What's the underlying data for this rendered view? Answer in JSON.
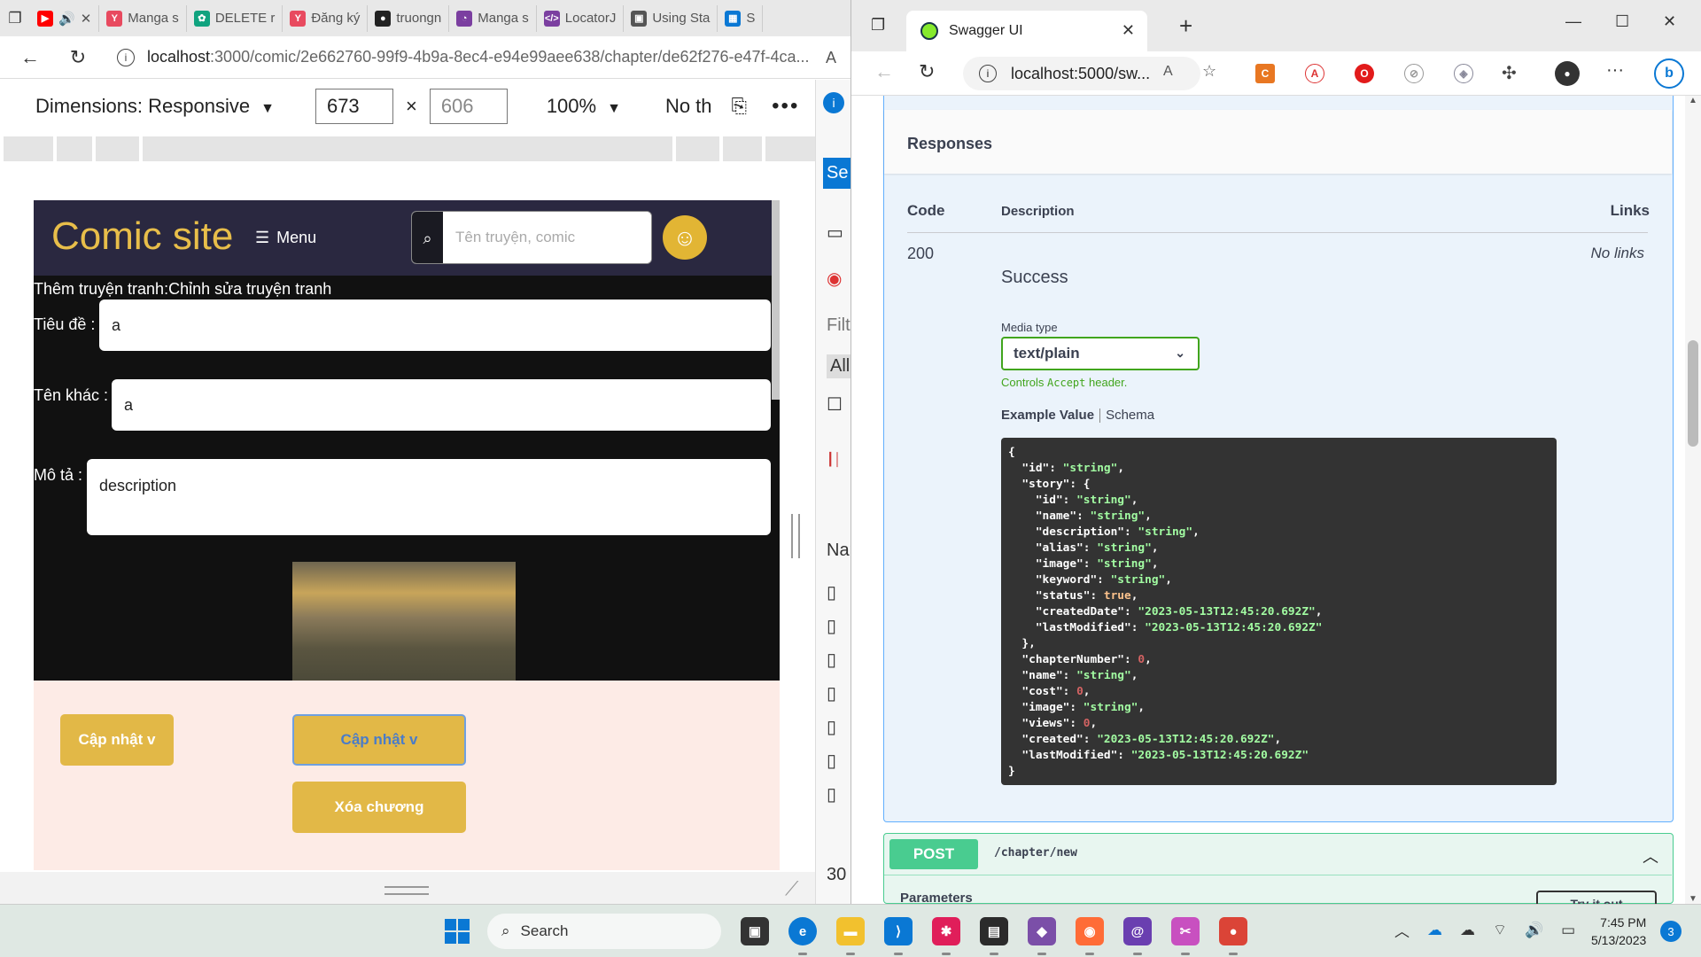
{
  "left_browser": {
    "tabs": [
      {
        "label": "",
        "icon": "youtube-icon",
        "color": "#ff0000"
      },
      {
        "label": "Manga s",
        "icon": "manga-icon",
        "color": "#e84a5f"
      },
      {
        "label": "DELETE r",
        "icon": "chatgpt-icon",
        "color": "#10a37f"
      },
      {
        "label": "Đăng ký",
        "icon": "manga-icon",
        "color": "#e84a5f"
      },
      {
        "label": "truongn",
        "icon": "github-icon",
        "color": "#222222"
      },
      {
        "label": "Manga s",
        "icon": "manga-icon",
        "color": "#7b3fa0"
      },
      {
        "label": "LocatorJ",
        "icon": "locator-icon",
        "color": "#7b3fa0"
      },
      {
        "label": "Using Sta",
        "icon": "video-icon",
        "color": "#555555"
      },
      {
        "label": "S",
        "icon": "windows-icon",
        "color": "#0a78d4"
      }
    ],
    "url_host": "localhost",
    "url_path": ":3000/comic/2e662760-99f9-4b9a-8ec4-e94e99aee638/chapter/de62f276-e47f-4ca...",
    "device_toolbar": {
      "dimensions_label": "Dimensions: Responsive",
      "width": "673",
      "height_placeholder": "606",
      "zoom": "100%",
      "throttle": "No th"
    },
    "site": {
      "logo": "Comic site",
      "menu_label": "Menu",
      "search_placeholder": "Tên truyện, comic",
      "form_title": "Thêm truyện tranh:Chỉnh sửa truyện tranh",
      "fields": {
        "title_label": "Tiêu đề :",
        "title_value": "a",
        "alt_label": "Tên khác :",
        "alt_value": "a",
        "desc_label": "Mô tả :",
        "desc_value": "description"
      },
      "buttons": {
        "update1": "Cập nhật v",
        "update2": "Cập nhật v",
        "delete": "Xóa chương"
      }
    },
    "devtools": {
      "se": "Se",
      "filter": "Filt",
      "all": "All",
      "name_col": "Nar",
      "count": "30"
    }
  },
  "right_browser": {
    "tab_title": "Swagger UI",
    "url": "localhost:5000/sw...",
    "swagger": {
      "responses_title": "Responses",
      "col_code": "Code",
      "col_description": "Description",
      "col_links": "Links",
      "code": "200",
      "description": "Success",
      "links": "No links",
      "media_type_label": "Media type",
      "media_type_value": "text/plain",
      "controls_hint_pre": "Controls ",
      "controls_hint_code": "Accept",
      "controls_hint_post": " header.",
      "example_value_tab": "Example Value",
      "schema_tab": "Schema",
      "example_json": [
        [
          [
            "p",
            "{"
          ]
        ],
        [
          [
            "p",
            "  "
          ],
          [
            "k",
            "\"id\""
          ],
          [
            "p",
            ": "
          ],
          [
            "s",
            "\"string\""
          ],
          [
            "p",
            ","
          ]
        ],
        [
          [
            "p",
            "  "
          ],
          [
            "k",
            "\"story\""
          ],
          [
            "p",
            ": {"
          ]
        ],
        [
          [
            "p",
            "    "
          ],
          [
            "k",
            "\"id\""
          ],
          [
            "p",
            ": "
          ],
          [
            "s",
            "\"string\""
          ],
          [
            "p",
            ","
          ]
        ],
        [
          [
            "p",
            "    "
          ],
          [
            "k",
            "\"name\""
          ],
          [
            "p",
            ": "
          ],
          [
            "s",
            "\"string\""
          ],
          [
            "p",
            ","
          ]
        ],
        [
          [
            "p",
            "    "
          ],
          [
            "k",
            "\"description\""
          ],
          [
            "p",
            ": "
          ],
          [
            "s",
            "\"string\""
          ],
          [
            "p",
            ","
          ]
        ],
        [
          [
            "p",
            "    "
          ],
          [
            "k",
            "\"alias\""
          ],
          [
            "p",
            ": "
          ],
          [
            "s",
            "\"string\""
          ],
          [
            "p",
            ","
          ]
        ],
        [
          [
            "p",
            "    "
          ],
          [
            "k",
            "\"image\""
          ],
          [
            "p",
            ": "
          ],
          [
            "s",
            "\"string\""
          ],
          [
            "p",
            ","
          ]
        ],
        [
          [
            "p",
            "    "
          ],
          [
            "k",
            "\"keyword\""
          ],
          [
            "p",
            ": "
          ],
          [
            "s",
            "\"string\""
          ],
          [
            "p",
            ","
          ]
        ],
        [
          [
            "p",
            "    "
          ],
          [
            "k",
            "\"status\""
          ],
          [
            "p",
            ": "
          ],
          [
            "b",
            "true"
          ],
          [
            "p",
            ","
          ]
        ],
        [
          [
            "p",
            "    "
          ],
          [
            "k",
            "\"createdDate\""
          ],
          [
            "p",
            ": "
          ],
          [
            "s",
            "\"2023-05-13T12:45:20.692Z\""
          ],
          [
            "p",
            ","
          ]
        ],
        [
          [
            "p",
            "    "
          ],
          [
            "k",
            "\"lastModified\""
          ],
          [
            "p",
            ": "
          ],
          [
            "s",
            "\"2023-05-13T12:45:20.692Z\""
          ]
        ],
        [
          [
            "p",
            "  },"
          ]
        ],
        [
          [
            "p",
            "  "
          ],
          [
            "k",
            "\"chapterNumber\""
          ],
          [
            "p",
            ": "
          ],
          [
            "n",
            "0"
          ],
          [
            "p",
            ","
          ]
        ],
        [
          [
            "p",
            "  "
          ],
          [
            "k",
            "\"name\""
          ],
          [
            "p",
            ": "
          ],
          [
            "s",
            "\"string\""
          ],
          [
            "p",
            ","
          ]
        ],
        [
          [
            "p",
            "  "
          ],
          [
            "k",
            "\"cost\""
          ],
          [
            "p",
            ": "
          ],
          [
            "n",
            "0"
          ],
          [
            "p",
            ","
          ]
        ],
        [
          [
            "p",
            "  "
          ],
          [
            "k",
            "\"image\""
          ],
          [
            "p",
            ": "
          ],
          [
            "s",
            "\"string\""
          ],
          [
            "p",
            ","
          ]
        ],
        [
          [
            "p",
            "  "
          ],
          [
            "k",
            "\"views\""
          ],
          [
            "p",
            ": "
          ],
          [
            "n",
            "0"
          ],
          [
            "p",
            ","
          ]
        ],
        [
          [
            "p",
            "  "
          ],
          [
            "k",
            "\"created\""
          ],
          [
            "p",
            ": "
          ],
          [
            "s",
            "\"2023-05-13T12:45:20.692Z\""
          ],
          [
            "p",
            ","
          ]
        ],
        [
          [
            "p",
            "  "
          ],
          [
            "k",
            "\"lastModified\""
          ],
          [
            "p",
            ": "
          ],
          [
            "s",
            "\"2023-05-13T12:45:20.692Z\""
          ]
        ],
        [
          [
            "p",
            "}"
          ]
        ]
      ],
      "post_method": "POST",
      "post_path": "/chapter/new",
      "parameters_label": "Parameters",
      "try_it_out": "Try it out"
    }
  },
  "taskbar": {
    "search_label": "Search",
    "apps": [
      {
        "name": "file-explorer-icon",
        "color": "#f2c12e"
      },
      {
        "name": "vscode-icon",
        "color": "#0a78d4"
      },
      {
        "name": "slack-icon",
        "color": "#e01e5a"
      },
      {
        "name": "terminal-icon",
        "color": "#2b2b2b"
      },
      {
        "name": "visual-studio-icon",
        "color": "#7b4fa8"
      },
      {
        "name": "postman-icon",
        "color": "#ff6c37"
      },
      {
        "name": "mongodb-compass-icon",
        "color": "#6a3fb0"
      },
      {
        "name": "snipping-tool-icon",
        "color": "#c850c0"
      },
      {
        "name": "chrome-icon",
        "color": "#db4437"
      }
    ],
    "time": "7:45 PM",
    "date": "5/13/2023",
    "notifications": "3"
  }
}
